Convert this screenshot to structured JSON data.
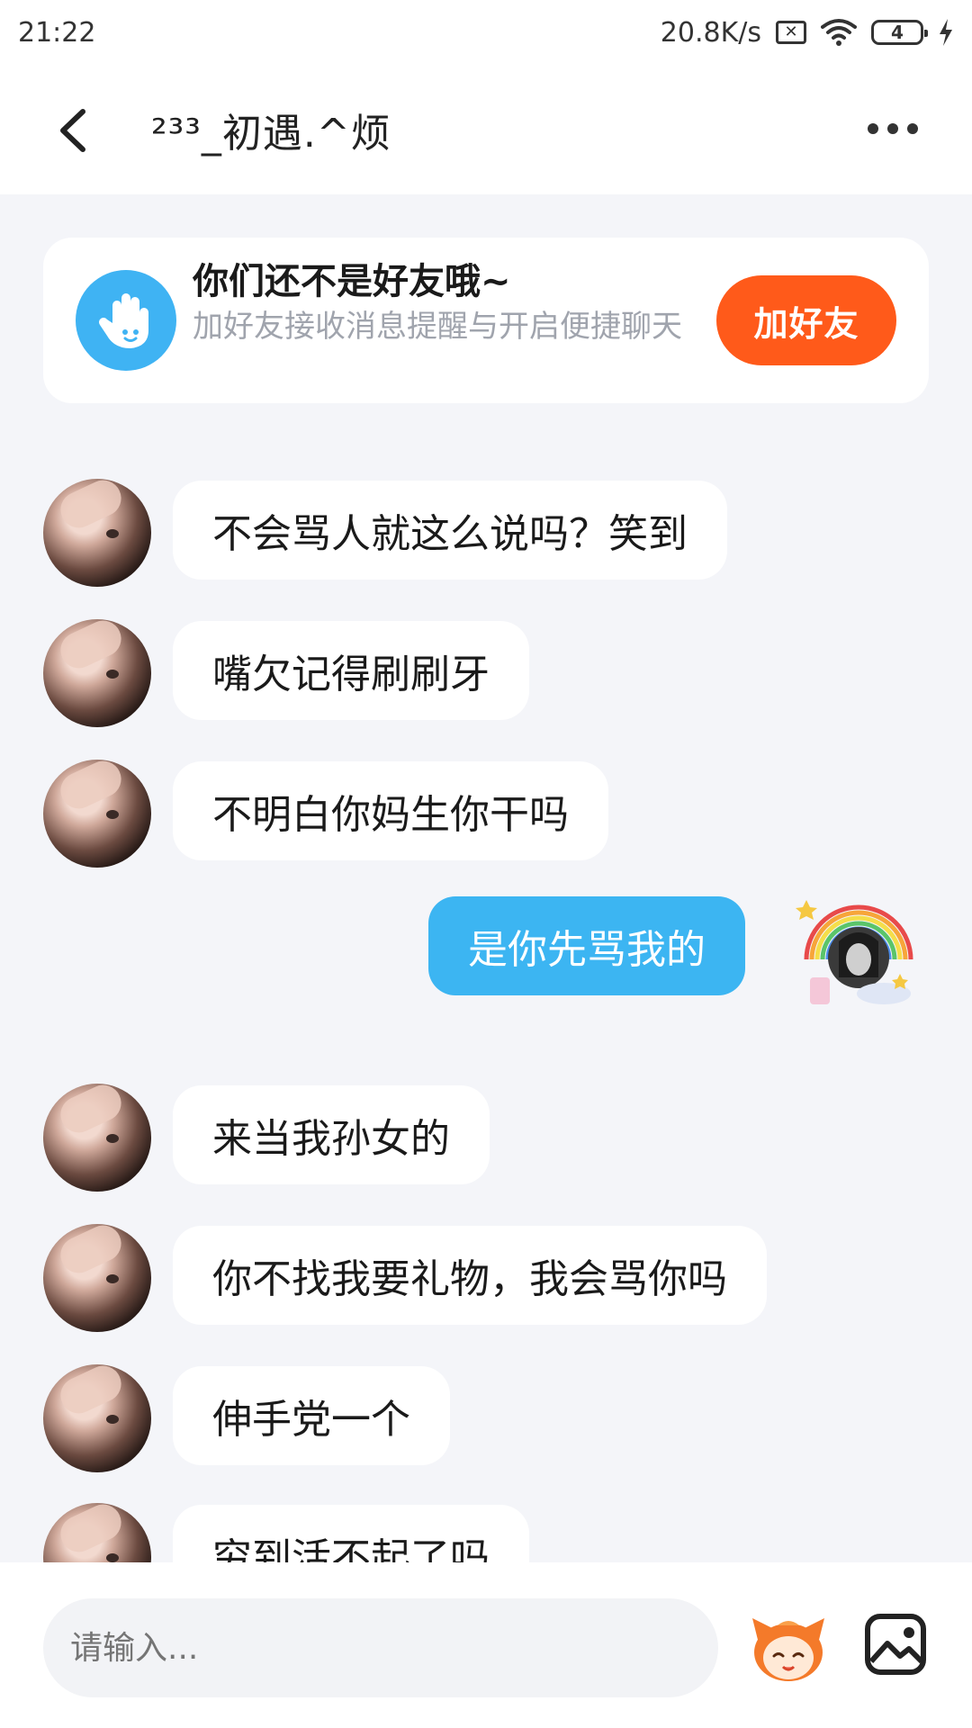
{
  "status_bar": {
    "time": "21:22",
    "speed": "20.8K/s",
    "battery": "4"
  },
  "header": {
    "title": "²³³_初遇.^烦"
  },
  "friend_card": {
    "title": "你们还不是好友哦~",
    "subtitle": "加好友接收消息提醒与开启便捷聊天",
    "button": "加好友"
  },
  "messages": [
    {
      "from": "them",
      "text": "不会骂人就这么说吗？笑到"
    },
    {
      "from": "them",
      "text": "嘴欠记得刷刷牙"
    },
    {
      "from": "them",
      "text": "不明白你妈生你干吗"
    },
    {
      "from": "me",
      "text": "是你先骂我的"
    },
    {
      "from": "them",
      "text": "来当我孙女的"
    },
    {
      "from": "them",
      "text": "你不找我要礼物，我会骂你吗"
    },
    {
      "from": "them",
      "text": "伸手党一个"
    },
    {
      "from": "them",
      "text": "穷到活不起了吗"
    }
  ],
  "input": {
    "placeholder": "请输入..."
  },
  "colors": {
    "accent_blue": "#3cb5f2",
    "add_friend_orange": "#ff5a1a",
    "background": "#f4f5f9"
  }
}
